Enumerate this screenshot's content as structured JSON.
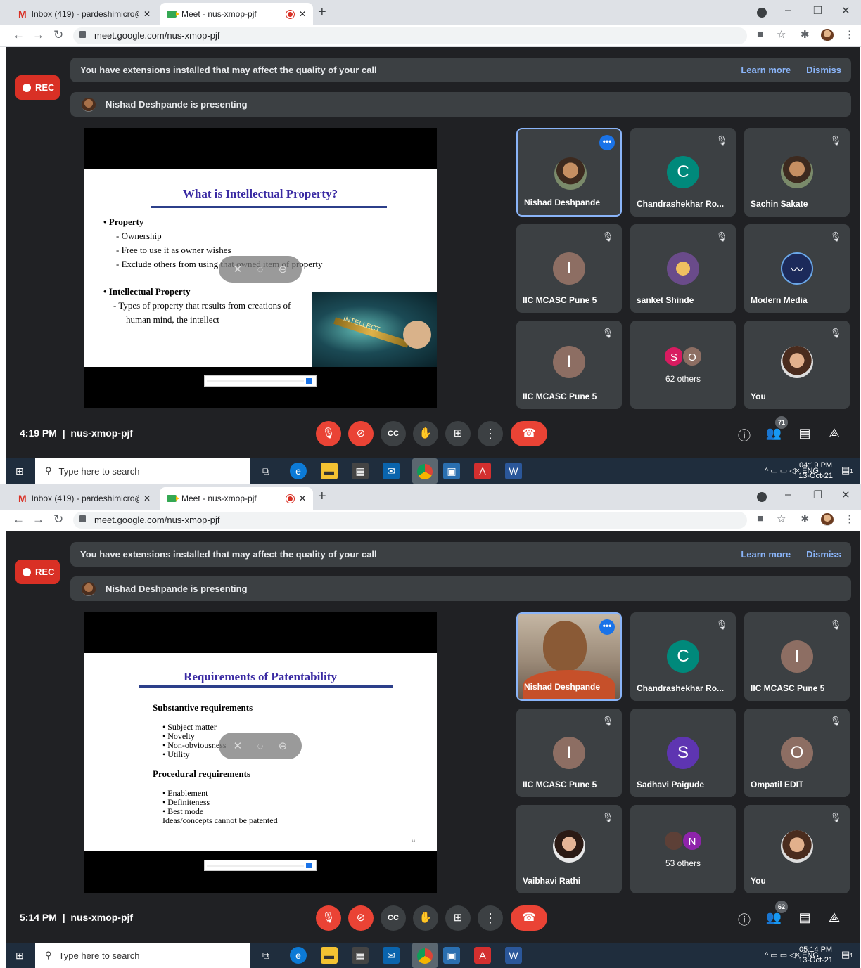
{
  "screens": [
    {
      "tabs": [
        {
          "title": "Inbox (419) - pardeshimicro@mc",
          "close": "✕"
        },
        {
          "title": "Meet - nus-xmop-pjf",
          "close": "✕"
        }
      ],
      "new_tab": "+",
      "url": "meet.google.com/nus-xmop-pjf",
      "rec_label": "REC",
      "banner": {
        "text": "You have extensions installed that may affect the quality of your call",
        "learn_more": "Learn more",
        "dismiss": "Dismiss"
      },
      "presenting": "Nishad Deshpande is presenting",
      "slide": {
        "title": "What is Intellectual Property?",
        "lines": [
          {
            "text": "• Property"
          },
          {
            "text": "- Ownership"
          },
          {
            "text": "- Free to use it as owner wishes"
          },
          {
            "text": "- Exclude others from using that owned item of property"
          },
          {
            "text": "• Intellectual Property"
          },
          {
            "text": "- Types of property that results from creations of"
          },
          {
            "text": "human mind, the intellect"
          }
        ],
        "key_label": "INTELLECT"
      },
      "participants": [
        {
          "name": "Nishad Deshpande",
          "initial": "",
          "color": "",
          "type": "photo"
        },
        {
          "name": "Chandrashekhar Ro...",
          "initial": "C",
          "color": "#00897b",
          "type": "initial"
        },
        {
          "name": "Sachin Sakate",
          "initial": "",
          "color": "",
          "type": "photo"
        },
        {
          "name": "IIC MCASC Pune 5",
          "initial": "I",
          "color": "#8d6e63",
          "type": "initial"
        },
        {
          "name": "sanket Shinde",
          "initial": "",
          "color": "",
          "type": "photo"
        },
        {
          "name": "Modern Media",
          "initial": "",
          "color": "",
          "type": "logo"
        },
        {
          "name": "IIC MCASC Pune 5",
          "initial": "I",
          "color": "#8d6e63",
          "type": "initial"
        },
        {
          "name": "62 others",
          "initials": [
            "S",
            "O"
          ],
          "colors": [
            "#d81b60",
            "#8d6e63"
          ],
          "type": "others"
        },
        {
          "name": "You",
          "initial": "",
          "color": "",
          "type": "photo"
        }
      ],
      "time": "4:19 PM",
      "meeting_code": "nus-xmop-pjf",
      "people_count": "71",
      "taskbar": {
        "search": "Type here to search",
        "lang": "ENG",
        "time": "04:19 PM",
        "date": "13-Oct-21",
        "notif": "1"
      }
    },
    {
      "tabs": [
        {
          "title": "Inbox (419) - pardeshimicro@mc",
          "close": "✕"
        },
        {
          "title": "Meet - nus-xmop-pjf",
          "close": "✕"
        }
      ],
      "new_tab": "+",
      "url": "meet.google.com/nus-xmop-pjf",
      "rec_label": "REC",
      "banner": {
        "text": "You have extensions installed that may affect the quality of your call",
        "learn_more": "Learn more",
        "dismiss": "Dismiss"
      },
      "presenting": "Nishad Deshpande is presenting",
      "slide": {
        "title": "Requirements of Patentability",
        "lines": [
          {
            "text": "Substantive  requirements"
          },
          {
            "text": "• Subject matter"
          },
          {
            "text": "• Novelty"
          },
          {
            "text": "• Non-obviousness"
          },
          {
            "text": "• Utility"
          },
          {
            "text": "Procedural requirements"
          },
          {
            "text": "• Enablement"
          },
          {
            "text": "• Definiteness"
          },
          {
            "text": "• Best mode"
          },
          {
            "text": "Ideas/concepts cannot be patented"
          }
        ],
        "page_no": "14"
      },
      "participants": [
        {
          "name": "Nishad Deshpande",
          "initial": "",
          "color": "",
          "type": "video"
        },
        {
          "name": "Chandrashekhar Ro...",
          "initial": "C",
          "color": "#00897b",
          "type": "initial"
        },
        {
          "name": "IIC MCASC Pune 5",
          "initial": "I",
          "color": "#8d6e63",
          "type": "initial"
        },
        {
          "name": "IIC MCASC Pune 5",
          "initial": "I",
          "color": "#8d6e63",
          "type": "initial"
        },
        {
          "name": "Sadhavi Paigude",
          "initial": "S",
          "color": "#5e35b1",
          "type": "initial"
        },
        {
          "name": "Ompatil EDIT",
          "initial": "O",
          "color": "#8d6e63",
          "type": "initial"
        },
        {
          "name": "Vaibhavi Rathi",
          "initial": "",
          "color": "",
          "type": "photo"
        },
        {
          "name": "53 others",
          "initials": [
            "",
            "N"
          ],
          "colors": [
            "#5d4037",
            "#8e24aa"
          ],
          "type": "others"
        },
        {
          "name": "You",
          "initial": "",
          "color": "",
          "type": "photo"
        }
      ],
      "time": "5:14 PM",
      "meeting_code": "nus-xmop-pjf",
      "people_count": "62",
      "taskbar": {
        "search": "Type here to search",
        "lang": "ENG",
        "time": "05:14 PM",
        "date": "13-Oct-21",
        "notif": "1"
      }
    }
  ],
  "colors": {
    "accent": "#8ab4f8",
    "rec": "#d93025",
    "end_call": "#ea4335",
    "meet_bg": "#202124",
    "tile_bg": "#3c4043"
  },
  "icons": [
    "gmail-icon",
    "meet-icon",
    "recording-dot-icon",
    "back-icon",
    "forward-icon",
    "reload-icon",
    "lock-icon",
    "camera-icon",
    "star-icon",
    "extensions-icon",
    "menu-icon",
    "mic-off-icon",
    "camera-off-icon",
    "captions-icon",
    "raise-hand-icon",
    "present-icon",
    "more-options-icon",
    "end-call-icon",
    "info-icon",
    "people-icon",
    "chat-icon",
    "activities-icon",
    "windows-start-icon",
    "search-icon",
    "task-view-icon",
    "edge-icon",
    "file-explorer-icon",
    "store-icon",
    "mail-icon",
    "chrome-icon",
    "app-icon",
    "acrobat-icon",
    "word-icon"
  ]
}
